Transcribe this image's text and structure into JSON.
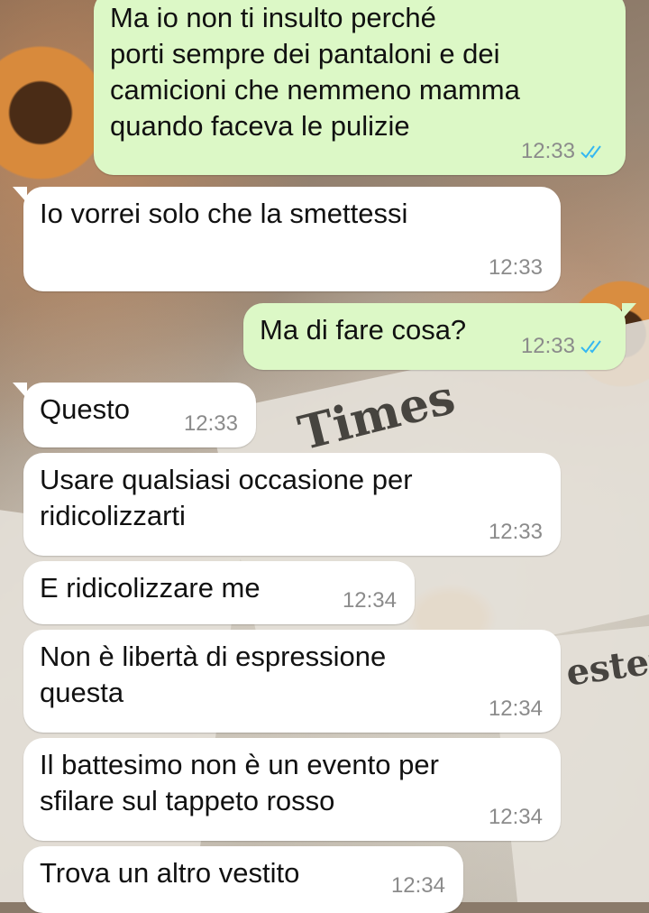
{
  "wallpaper": {
    "newspaper_text_1": "Times",
    "newspaper_text_2": "ester"
  },
  "messages": [
    {
      "direction": "out",
      "text": "Ma io non ti insulto perché\nporti sempre dei pantaloni e dei\ncamicioni che nemmeno mamma\nquando faceva le pulizie",
      "time": "12:33",
      "status": "read"
    },
    {
      "direction": "in",
      "text": "Io vorrei solo che la smettessi",
      "time": "12:33"
    },
    {
      "direction": "out",
      "text": "Ma di fare cosa?",
      "time": "12:33",
      "status": "read"
    },
    {
      "direction": "in",
      "text": "Questo",
      "time": "12:33"
    },
    {
      "direction": "in",
      "text": "Usare qualsiasi occasione per\nridicolizzarti",
      "time": "12:33"
    },
    {
      "direction": "in",
      "text": "E ridicolizzare me",
      "time": "12:34"
    },
    {
      "direction": "in",
      "text": "Non è libertà di espressione\nquesta",
      "time": "12:34"
    },
    {
      "direction": "in",
      "text": "Il battesimo non è un evento per\nsfilare sul tappeto rosso",
      "time": "12:34"
    },
    {
      "direction": "in",
      "text": "Trova un altro vestito",
      "time": "12:34"
    }
  ],
  "colors": {
    "incoming_bubble": "#ffffff",
    "outgoing_bubble": "#dcf8c6",
    "timestamp": "#8b8b8b",
    "read_ticks": "#34b7f1"
  },
  "icons": {
    "read_status": "double-check-icon"
  }
}
